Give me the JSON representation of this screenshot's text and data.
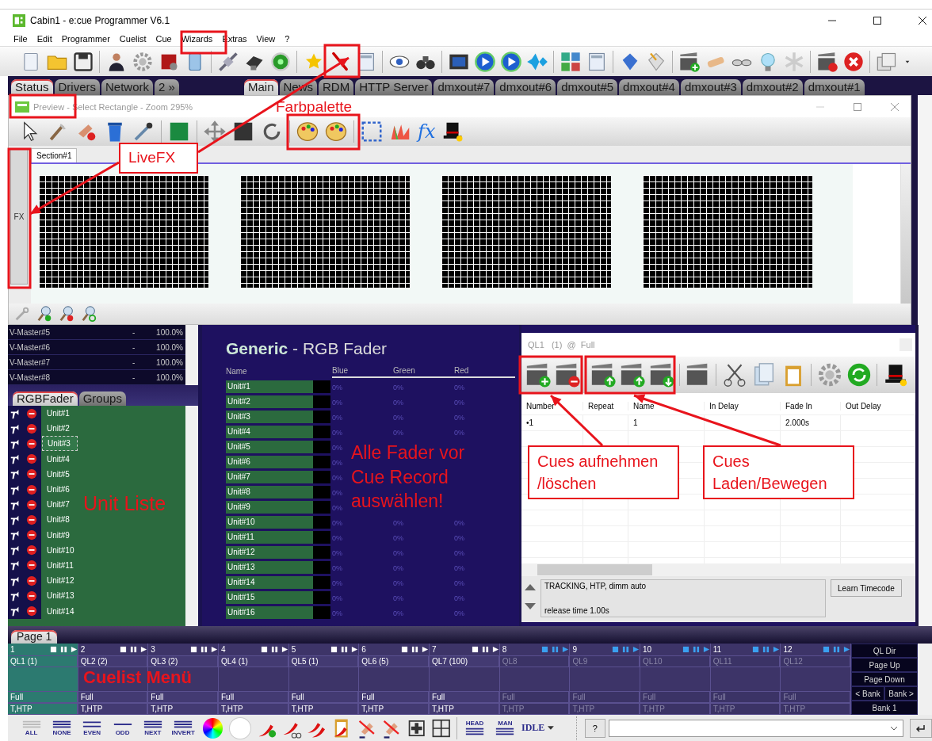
{
  "window": {
    "title": "Cabin1 - e:cue Programmer V6.1"
  },
  "menu": [
    {
      "label": "File"
    },
    {
      "label": "Edit"
    },
    {
      "label": "Programmer"
    },
    {
      "label": "Cuelist"
    },
    {
      "label": "Cue"
    },
    {
      "label": "Wizards"
    },
    {
      "label": "Extras"
    },
    {
      "label": "View"
    },
    {
      "label": "?"
    }
  ],
  "left_tabs": [
    {
      "label": "Status",
      "selected": true
    },
    {
      "label": "Drivers",
      "selected": false
    },
    {
      "label": "Network",
      "selected": false
    },
    {
      "label": "2 »",
      "selected": false
    }
  ],
  "main_tabs": [
    {
      "label": "Main",
      "selected": true
    },
    {
      "label": "News",
      "selected": false
    },
    {
      "label": "RDM",
      "selected": false
    },
    {
      "label": "HTTP Server",
      "selected": false
    },
    {
      "label": "dmxout#7",
      "selected": false
    },
    {
      "label": "dmxout#6",
      "selected": false
    },
    {
      "label": "dmxout#5",
      "selected": false
    },
    {
      "label": "dmxout#4",
      "selected": false
    },
    {
      "label": "dmxout#3",
      "selected": false
    },
    {
      "label": "dmxout#2",
      "selected": false
    },
    {
      "label": "dmxout#1",
      "selected": false
    }
  ],
  "preview": {
    "title": "Preview - Select Rectangle - Zoom 295%",
    "fx_tool": "fx",
    "side_button": "FX",
    "tabs": [
      {
        "label": "Section#1",
        "selected": true
      }
    ]
  },
  "vmasters": [
    {
      "name": "V-Master#5",
      "dash": "-",
      "value": "100.0%"
    },
    {
      "name": "V-Master#6",
      "dash": "-",
      "value": "100.0%"
    },
    {
      "name": "V-Master#7",
      "dash": "-",
      "value": "100.0%"
    },
    {
      "name": "V-Master#8",
      "dash": "-",
      "value": "100.0%"
    }
  ],
  "unit_tabs": [
    {
      "label": "RGBFader",
      "selected": true
    },
    {
      "label": "Groups",
      "selected": false
    }
  ],
  "units": [
    {
      "name": "Unit#1",
      "focused": false
    },
    {
      "name": "Unit#2",
      "focused": false
    },
    {
      "name": "Unit#3",
      "focused": true
    },
    {
      "name": "Unit#4",
      "focused": false
    },
    {
      "name": "Unit#5",
      "focused": false
    },
    {
      "name": "Unit#6",
      "focused": false
    },
    {
      "name": "Unit#7",
      "focused": false
    },
    {
      "name": "Unit#8",
      "focused": false
    },
    {
      "name": "Unit#9",
      "focused": false
    },
    {
      "name": "Unit#10",
      "focused": false
    },
    {
      "name": "Unit#11",
      "focused": false
    },
    {
      "name": "Unit#12",
      "focused": false
    },
    {
      "name": "Unit#13",
      "focused": false
    },
    {
      "name": "Unit#14",
      "focused": false
    }
  ],
  "fader": {
    "title": "**Generic** - RGB Fader",
    "columns": [
      "Name",
      "Blue",
      "Green",
      "Red"
    ],
    "rows": [
      {
        "name": "Unit#1",
        "values": [
          "0%",
          "0%",
          "0%"
        ]
      },
      {
        "name": "Unit#2",
        "values": [
          "0%",
          "0%",
          "0%"
        ]
      },
      {
        "name": "Unit#3",
        "values": [
          "0%",
          "0%",
          "0%"
        ]
      },
      {
        "name": "Unit#4",
        "values": [
          "0%",
          "0%",
          "0%"
        ]
      },
      {
        "name": "Unit#5",
        "values": [
          "0%"
        ]
      },
      {
        "name": "Unit#6",
        "values": [
          "0%"
        ]
      },
      {
        "name": "Unit#7",
        "values": [
          "0%"
        ]
      },
      {
        "name": "Unit#8",
        "values": [
          "0%"
        ]
      },
      {
        "name": "Unit#9",
        "values": [
          "0%"
        ]
      },
      {
        "name": "Unit#10",
        "values": [
          "0%",
          "0%",
          "0%"
        ]
      },
      {
        "name": "Unit#11",
        "values": [
          "0%",
          "0%",
          "0%"
        ]
      },
      {
        "name": "Unit#12",
        "values": [
          "0%",
          "0%",
          "0%"
        ]
      },
      {
        "name": "Unit#13",
        "values": [
          "0%",
          "0%",
          "0%"
        ]
      },
      {
        "name": "Unit#14",
        "values": [
          "0%",
          "0%",
          "0%"
        ]
      },
      {
        "name": "Unit#15",
        "values": [
          "0%",
          "0%",
          "0%"
        ]
      },
      {
        "name": "Unit#16",
        "values": [
          "0%",
          "0%",
          "0%"
        ]
      }
    ]
  },
  "cuelist": {
    "title": "QL1   (1)  @  Full",
    "columns": [
      "Number",
      "Repeat",
      "Name",
      "In Delay",
      "Fade In",
      "Out Delay"
    ],
    "rows": [
      {
        "number": "•1",
        "name": "1",
        "fade_in": "2.000s"
      }
    ],
    "status_lines": [
      "TRACKING, HTP, dimm auto",
      "release time 1.00s"
    ],
    "button": "Learn Timecode"
  },
  "page_tabs": [
    {
      "label": "Page 1",
      "selected": true
    }
  ],
  "cuelists": [
    {
      "number": "1",
      "name": "QL1 (1)",
      "level": "Full",
      "mode": "T,HTP",
      "selected": true,
      "disabled": false
    },
    {
      "number": "2",
      "name": "QL2 (2)",
      "level": "Full",
      "mode": "T,HTP",
      "selected": false,
      "disabled": false
    },
    {
      "number": "3",
      "name": "QL3 (2)",
      "level": "Full",
      "mode": "T,HTP",
      "selected": false,
      "disabled": false
    },
    {
      "number": "4",
      "name": "QL4 (1)",
      "level": "Full",
      "mode": "T,HTP",
      "selected": false,
      "disabled": false
    },
    {
      "number": "5",
      "name": "QL5 (1)",
      "level": "Full",
      "mode": "T,HTP",
      "selected": false,
      "disabled": false
    },
    {
      "number": "6",
      "name": "QL6 (5)",
      "level": "Full",
      "mode": "T,HTP",
      "selected": false,
      "disabled": false
    },
    {
      "number": "7",
      "name": "QL7 (100)",
      "level": "Full",
      "mode": "T,HTP",
      "selected": false,
      "disabled": false
    },
    {
      "number": "8",
      "name": "QL8",
      "level": "Full",
      "mode": "T,HTP",
      "selected": false,
      "disabled": true
    },
    {
      "number": "9",
      "name": "QL9",
      "level": "Full",
      "mode": "T,HTP",
      "selected": false,
      "disabled": true
    },
    {
      "number": "10",
      "name": "QL10",
      "level": "Full",
      "mode": "T,HTP",
      "selected": false,
      "disabled": true
    },
    {
      "number": "11",
      "name": "QL11",
      "level": "Full",
      "mode": "T,HTP",
      "selected": false,
      "disabled": true
    },
    {
      "number": "12",
      "name": "QL12",
      "level": "Full",
      "mode": "T,HTP",
      "selected": false,
      "disabled": true
    }
  ],
  "bank_buttons": [
    "QL Dir",
    "Page Up",
    "Page Down",
    "< Bank",
    "Bank >",
    "Bank 1"
  ],
  "selection_tools": [
    {
      "label": "ALL"
    },
    {
      "label": "NONE"
    },
    {
      "label": "EVEN"
    },
    {
      "label": "ODD"
    },
    {
      "label": "NEXT"
    },
    {
      "label": "INVERT"
    }
  ],
  "mode_tools": [
    {
      "label": "HEAD"
    },
    {
      "label": "MAN"
    }
  ],
  "idle": "IDLE",
  "help_button": "?",
  "annotations": [
    {
      "text": "Farbpalette",
      "kind": "note"
    },
    {
      "text": "LiveFX",
      "kind": "callout"
    },
    {
      "text": "Alle Fader vor Cue Record auswählen!",
      "kind": "note"
    },
    {
      "text": "Cues aufnehmen /löschen",
      "kind": "callout"
    },
    {
      "text": "Cues Laden/Bewegen",
      "kind": "callout"
    },
    {
      "text": "Unit Liste",
      "kind": "note"
    },
    {
      "text": "Cuelist Menü",
      "kind": "note"
    }
  ]
}
